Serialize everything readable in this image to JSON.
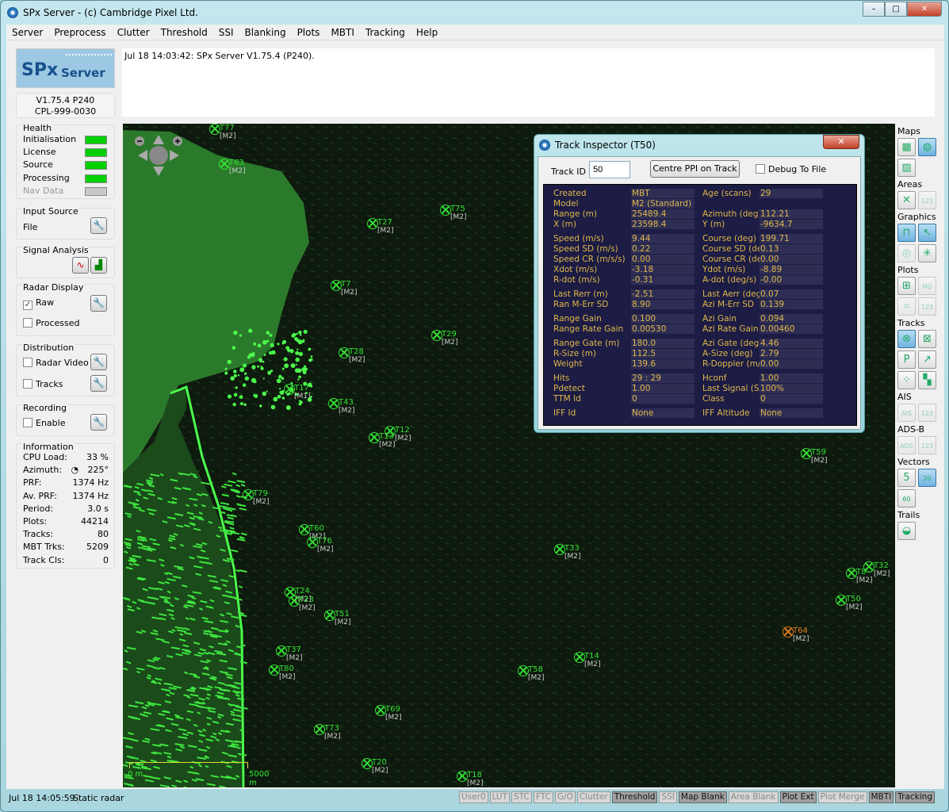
{
  "window": {
    "title": "SPx Server - (c) Cambridge Pixel Ltd.",
    "min": "–",
    "max": "□",
    "close": "✕"
  },
  "menu": [
    "Server",
    "Preprocess",
    "Clutter",
    "Threshold",
    "SSI",
    "Blanking",
    "Plots",
    "MBTI",
    "Tracking",
    "Help"
  ],
  "logo": {
    "text1": "SPx",
    "text2": "Server"
  },
  "version": {
    "line1": "V1.75.4 P240",
    "line2": "CPL-999-0030"
  },
  "health": {
    "title": "Health",
    "items": [
      {
        "label": "Initialisation",
        "ok": true
      },
      {
        "label": "License",
        "ok": true
      },
      {
        "label": "Source",
        "ok": true
      },
      {
        "label": "Processing",
        "ok": true
      },
      {
        "label": "Nav Data",
        "ok": false
      }
    ],
    "ok_color": "#00d000"
  },
  "input_source": {
    "title": "Input Source",
    "value": "File"
  },
  "signal_analysis": {
    "title": "Signal Analysis"
  },
  "radar_display": {
    "title": "Radar Display",
    "raw": {
      "label": "Raw",
      "checked": true
    },
    "processed": {
      "label": "Processed",
      "checked": false
    }
  },
  "distribution": {
    "title": "Distribution",
    "radar_video": {
      "label": "Radar Video",
      "checked": false
    },
    "tracks": {
      "label": "Tracks",
      "checked": false
    }
  },
  "recording": {
    "title": "Recording",
    "enable": {
      "label": "Enable",
      "checked": false
    }
  },
  "information": {
    "title": "Information",
    "rows": [
      {
        "k": "CPU Load:",
        "v": "33 %"
      },
      {
        "k": "Azimuth:",
        "v": "225°"
      },
      {
        "k": "PRF:",
        "v": "1374 Hz"
      },
      {
        "k": "Av. PRF:",
        "v": "1374 Hz"
      },
      {
        "k": "Period:",
        "v": "3.0 s"
      },
      {
        "k": "Plots:",
        "v": "44214"
      },
      {
        "k": "Tracks:",
        "v": "80"
      },
      {
        "k": "MBT Trks:",
        "v": "5209"
      },
      {
        "k": "Track Cls:",
        "v": "0"
      }
    ]
  },
  "log": {
    "message": "Jul 18 14:03:42: SPx Server V1.75.4 (P240)."
  },
  "radar": {
    "scale_start": "0 m",
    "scale_end": "5000 m",
    "tracks": [
      {
        "id": "T77",
        "cls": "[M2]"
      },
      {
        "id": "T63",
        "cls": "[M2]"
      },
      {
        "id": "T27",
        "cls": "[M2]"
      },
      {
        "id": "T75",
        "cls": "[M2]"
      },
      {
        "id": "T7",
        "cls": "[M2]"
      },
      {
        "id": "T29",
        "cls": "[M2]"
      },
      {
        "id": "T28",
        "cls": "[M2]"
      },
      {
        "id": "T17",
        "cls": "[M1]"
      },
      {
        "id": "T43",
        "cls": "[M2]"
      },
      {
        "id": "T12",
        "cls": "[M2]"
      },
      {
        "id": "T13",
        "cls": "[M2]"
      },
      {
        "id": "T79",
        "cls": "[M2]"
      },
      {
        "id": "T60",
        "cls": "[M2]"
      },
      {
        "id": "T76",
        "cls": "[M2]"
      },
      {
        "id": "T33",
        "cls": "[M2]"
      },
      {
        "id": "T24",
        "cls": "[M2]"
      },
      {
        "id": "T23",
        "cls": "[M2]"
      },
      {
        "id": "T51",
        "cls": "[M2]"
      },
      {
        "id": "T37",
        "cls": "[M2]"
      },
      {
        "id": "T80",
        "cls": "[M2]"
      },
      {
        "id": "T14",
        "cls": "[M2]"
      },
      {
        "id": "T58",
        "cls": "[M2]"
      },
      {
        "id": "T69",
        "cls": "[M2]"
      },
      {
        "id": "T73",
        "cls": "[M2]"
      },
      {
        "id": "T20",
        "cls": "[M2]"
      },
      {
        "id": "T18",
        "cls": "[M2]"
      },
      {
        "id": "T59",
        "cls": "[M2]"
      },
      {
        "id": "T8",
        "cls": "[M2]"
      },
      {
        "id": "T32",
        "cls": "[M2]"
      },
      {
        "id": "T50",
        "cls": "[M2]"
      },
      {
        "id": "T64",
        "cls": "[M2]",
        "selected": true
      }
    ],
    "track_color": "#35e035",
    "selected_color": "#e07a20"
  },
  "toolbar": {
    "sections": [
      {
        "label": "Maps",
        "buttons": [
          {
            "icon": "map-grid-icon",
            "on": false
          },
          {
            "icon": "globe-icon",
            "on": true
          },
          {
            "icon": "land-map-icon",
            "on": false
          }
        ]
      },
      {
        "label": "Areas",
        "buttons": [
          {
            "icon": "area-cross-icon",
            "on": false
          },
          {
            "icon": "area-numbers-icon",
            "on": false,
            "dim": true
          }
        ]
      },
      {
        "label": "Graphics",
        "buttons": [
          {
            "icon": "scale-bar-icon",
            "on": true
          },
          {
            "icon": "cursor-readout-icon",
            "on": true
          },
          {
            "icon": "range-rings-icon",
            "on": false,
            "dim": true
          },
          {
            "icon": "spokes-icon",
            "on": false
          }
        ]
      },
      {
        "label": "Plots",
        "buttons": [
          {
            "icon": "plot-cross-icon",
            "on": false
          },
          {
            "icon": "plot-nq-icon",
            "on": false,
            "dim": true
          },
          {
            "icon": "plot-box-icon",
            "on": false,
            "dim": true
          },
          {
            "icon": "plot-numbers-icon",
            "on": false,
            "dim": true
          }
        ]
      },
      {
        "label": "Tracks",
        "buttons": [
          {
            "icon": "track-symbol-icon",
            "on": true
          },
          {
            "icon": "track-box-icon",
            "on": false
          },
          {
            "icon": "track-p-icon",
            "on": false
          },
          {
            "icon": "track-vector-axes-icon",
            "on": false
          },
          {
            "icon": "track-multi-icon",
            "on": false
          },
          {
            "icon": "track-heatmap-icon",
            "on": false
          }
        ]
      },
      {
        "label": "AIS",
        "buttons": [
          {
            "icon": "ais-icon",
            "on": false,
            "dim": true
          },
          {
            "icon": "ais-numbers-icon",
            "on": false,
            "dim": true
          }
        ]
      },
      {
        "label": "ADS-B",
        "buttons": [
          {
            "icon": "adsb-icon",
            "on": false,
            "dim": true
          },
          {
            "icon": "adsb-numbers-icon",
            "on": false,
            "dim": true
          }
        ]
      },
      {
        "label": "Vectors",
        "buttons": [
          {
            "icon": "vector-5-icon",
            "on": false
          },
          {
            "icon": "vector-20-icon",
            "on": true
          },
          {
            "icon": "vector-60-icon",
            "on": false
          }
        ]
      },
      {
        "label": "Trails",
        "buttons": [
          {
            "icon": "trails-icon",
            "on": false
          }
        ]
      }
    ]
  },
  "status": {
    "time": "Jul 18 14:05:59",
    "mode": "Static radar",
    "badges": [
      {
        "label": "User0",
        "active": false
      },
      {
        "label": "LUT",
        "active": false
      },
      {
        "label": "STC",
        "active": false
      },
      {
        "label": "FTC",
        "active": false
      },
      {
        "label": "G/O",
        "active": false
      },
      {
        "label": "Clutter",
        "active": false
      },
      {
        "label": "Threshold",
        "active": true
      },
      {
        "label": "SSI",
        "active": false
      },
      {
        "label": "Map Blank",
        "active": true
      },
      {
        "label": "Area Blank",
        "active": false
      },
      {
        "label": "Plot Ext",
        "active": true
      },
      {
        "label": "Plot Merge",
        "active": false
      },
      {
        "label": "MBTI",
        "active": true
      },
      {
        "label": "Tracking",
        "active": true
      }
    ]
  },
  "inspector": {
    "title": "Track Inspector (T50)",
    "close": "✕",
    "track_id_label": "Track ID",
    "track_id_value": "50",
    "centre_button": "Centre PPI on Track",
    "debug_label": "Debug To File",
    "debug_checked": false,
    "groups": [
      [
        [
          "Created",
          "MBT",
          "Age (scans)",
          "29"
        ],
        [
          "Model",
          "M2 (Standard)",
          "",
          ""
        ],
        [
          "Range (m)",
          "25489.4",
          "Azimuth (deg)",
          "112.21"
        ],
        [
          "X (m)",
          "23598.4",
          "Y (m)",
          "-9634.7"
        ]
      ],
      [
        [
          "Speed (m/s)",
          "9.44",
          "Course (deg)",
          "199.71"
        ],
        [
          "Speed SD (m/s)",
          "0.22",
          "Course SD (deg)",
          "0.13"
        ],
        [
          "Speed CR (m/s/s)",
          "0.00",
          "Course CR (deg/s)",
          "0.00"
        ],
        [
          "Xdot (m/s)",
          "-3.18",
          "Ydot (m/s)",
          "-8.89"
        ],
        [
          "R-dot (m/s)",
          "-0.31",
          "A-dot (deg/s)",
          "-0.00"
        ]
      ],
      [
        [
          "Last Rerr (m)",
          "-2.51",
          "Last Aerr (deg)",
          "0.07"
        ],
        [
          "Ran M-Err SD",
          "8.90",
          "Azi M-Err SD",
          "0.139"
        ]
      ],
      [
        [
          "Range Gain",
          "0.100",
          "Azi Gain",
          "0.094"
        ],
        [
          "Range Rate Gain",
          "0.00530",
          "Azi Rate Gain",
          "0.00460"
        ]
      ],
      [
        [
          "Range Gate (m)",
          "180.0",
          "Azi Gate (deg)",
          "4.46"
        ],
        [
          "R-Size (m)",
          "112.5",
          "A-Size (deg)",
          "2.79"
        ],
        [
          "Weight",
          "139.6",
          "R-Doppler (m/s)",
          "0.00"
        ]
      ],
      [
        [
          "Hits",
          "29 : 29",
          "Hconf",
          "1.00"
        ],
        [
          "Pdetect",
          "1.00",
          "Last Signal (S/W)",
          "100%"
        ],
        [
          "TTM Id",
          "0",
          "Class",
          "0"
        ]
      ],
      [
        [
          "IFF Id",
          "None",
          "IFF Altitude",
          "None"
        ]
      ]
    ]
  }
}
